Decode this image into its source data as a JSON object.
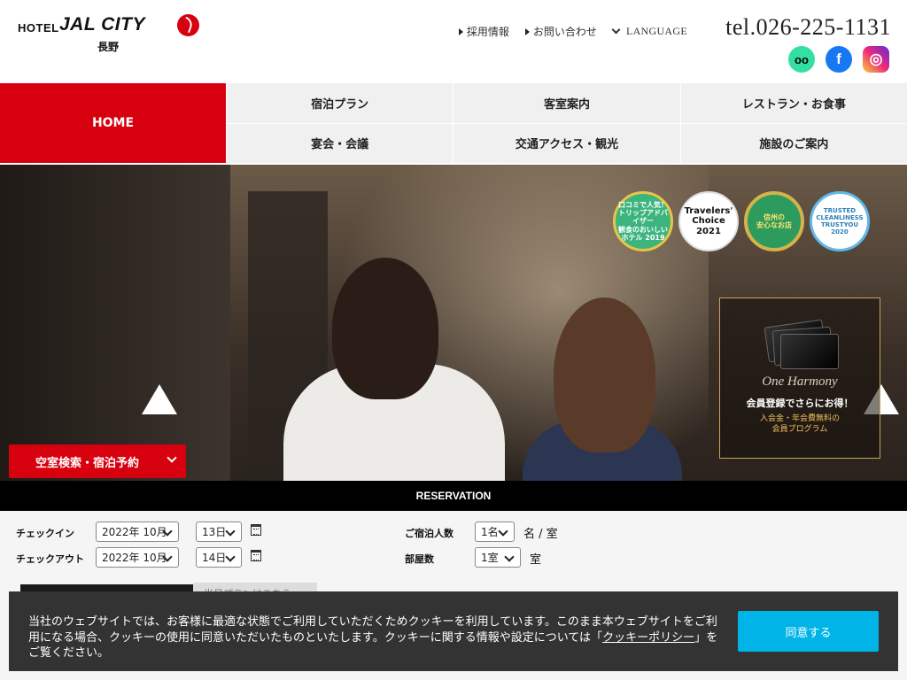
{
  "header": {
    "logo_hotel": "HOTEL",
    "logo_brand": "JAL CITY",
    "logo_sub": "長野",
    "links": [
      "採用情報",
      "お問い合わせ"
    ],
    "language": "LANGUAGE",
    "tel": "tel.026-225-1131",
    "social": [
      "tripadvisor-icon",
      "facebook-icon",
      "instagram-icon"
    ]
  },
  "nav": {
    "home": "HOME",
    "items": [
      "宿泊プラン",
      "客室案内",
      "レストラン・お食事",
      "宴会・会議",
      "交通アクセス・観光",
      "施設のご案内"
    ]
  },
  "hero": {
    "badges": [
      {
        "line1": "口コミで人気！",
        "line2": "トリップアドバイザー",
        "line3": "観食のおいしいホテル 2019"
      },
      {
        "line1": "Travelers'",
        "line2": "Choice",
        "line3": "2021"
      },
      {
        "line1": "信州の",
        "line2": "安心なお店",
        "line3": ""
      },
      {
        "line1": "TRUSTED",
        "line2": "CLEANLINESS",
        "line3": "TRUSTYOU 2020"
      }
    ],
    "member": {
      "logo": "One Harmony",
      "title": "会員登録でさらにお得！",
      "desc": "入会金・年会費無料の\n会員プログラム"
    },
    "search_button": "空室検索・宿泊予約"
  },
  "reservation": {
    "bar": "RESERVATION",
    "checkin_label": "チェックイン",
    "checkout_label": "チェックアウト",
    "checkin_month": "2022年 10月",
    "checkin_day": "13日",
    "checkout_month": "2022年 10月",
    "checkout_day": "14日",
    "guests_label": "ご宿泊人数",
    "guests_value": "1名",
    "guests_unit": "名 / 室",
    "rooms_label": "部屋数",
    "rooms_value": "1室",
    "rooms_unit": "室",
    "partial_text": "当日プランはこちら"
  },
  "cookie": {
    "text_before": "当社のウェブサイトでは、お客様に最適な状態でご利用していただくためクッキーを利用しています。このまま本ウェブサイトをご利用になる場合、クッキーの使用に同意いただいたものといたします。クッキーに関する情報や設定については「",
    "link": "クッキーポリシー",
    "text_after": "」をご覧ください。",
    "agree": "同意する"
  },
  "colors": {
    "brand_red": "#d7000f",
    "agree_blue": "#00b4e8"
  }
}
